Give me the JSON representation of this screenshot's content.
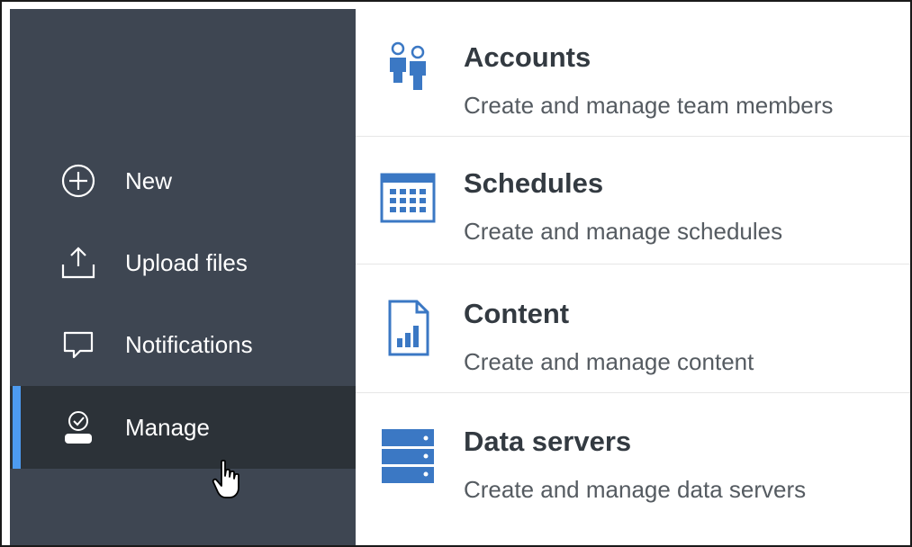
{
  "sidebar": {
    "items": [
      {
        "label": "New",
        "icon": "plus-circle-icon"
      },
      {
        "label": "Upload files",
        "icon": "upload-icon"
      },
      {
        "label": "Notifications",
        "icon": "speech-bubble-icon"
      },
      {
        "label": "Manage",
        "icon": "manage-user-check-icon",
        "active": true
      }
    ]
  },
  "main": {
    "items": [
      {
        "title": "Accounts",
        "description": "Create and manage team members",
        "icon": "users-icon"
      },
      {
        "title": "Schedules",
        "description": "Create and manage schedules",
        "icon": "calendar-icon"
      },
      {
        "title": "Content",
        "description": "Create and manage content",
        "icon": "report-chart-icon"
      },
      {
        "title": "Data servers",
        "description": "Create and manage data servers",
        "icon": "server-icon"
      }
    ]
  },
  "colors": {
    "sidebar_bg": "#3e4652",
    "sidebar_active_bg": "#2c3238",
    "accent": "#4d9bf0",
    "icon_blue": "#3b78c4",
    "title_text": "#333a41",
    "desc_text": "#555b61"
  }
}
